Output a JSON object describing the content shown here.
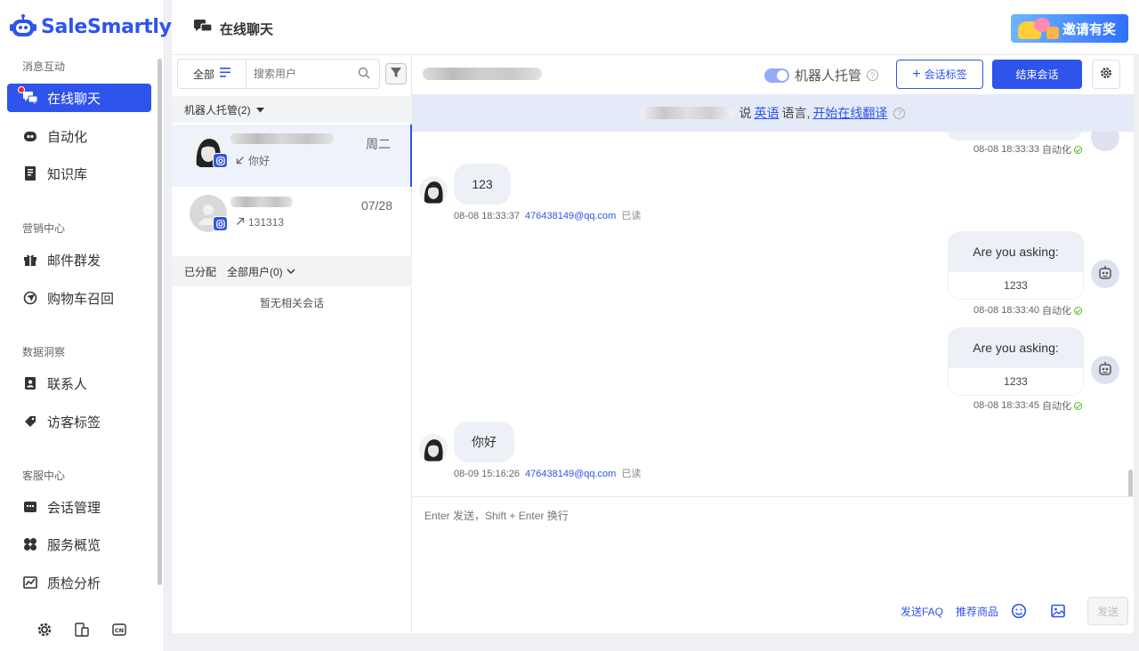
{
  "app": {
    "brand": "SaleSmartly",
    "invite_label": "邀请有奖"
  },
  "header": {
    "title": "在线聊天"
  },
  "sidebar": {
    "sections": [
      {
        "title": "消息互动",
        "items": [
          {
            "label": "在线聊天",
            "icon": "chat-icon",
            "active": true
          },
          {
            "label": "自动化",
            "icon": "robot-icon"
          },
          {
            "label": "知识库",
            "icon": "book-icon"
          }
        ]
      },
      {
        "title": "营销中心",
        "items": [
          {
            "label": "邮件群发",
            "icon": "gift-icon"
          },
          {
            "label": "购物车召回",
            "icon": "cart-recall-icon"
          }
        ]
      },
      {
        "title": "数据洞察",
        "items": [
          {
            "label": "联系人",
            "icon": "contact-icon"
          },
          {
            "label": "访客标签",
            "icon": "tag-icon"
          }
        ]
      },
      {
        "title": "客服中心",
        "items": [
          {
            "label": "会话管理",
            "icon": "session-icon"
          },
          {
            "label": "服务概览",
            "icon": "overview-icon"
          },
          {
            "label": "质检分析",
            "icon": "chart-icon"
          }
        ]
      }
    ],
    "bottom_icons": [
      "settings-icon",
      "device-icon",
      "language-icon"
    ],
    "language_code": "CN"
  },
  "conversation_list": {
    "filter_label": "全部",
    "search_placeholder": "搜索用户",
    "robot_group_label": "机器人托管(2)",
    "conversations": [
      {
        "date": "周二",
        "preview": "你好",
        "direction": "incoming"
      },
      {
        "date": "07/28",
        "preview": "131313",
        "direction": "outgoing"
      }
    ],
    "assigned_label": "已分配",
    "assigned_filter": "全部用户(0)",
    "empty_text": "暂无相关会话"
  },
  "chat": {
    "robot_toggle_label": "机器人托管",
    "tag_button": "会话标签",
    "end_button": "结束会话",
    "translate": {
      "says": "说",
      "language": "英语",
      "lang_suffix": "语言,",
      "action": "开始在线翻译"
    },
    "messages": [
      {
        "type": "out-meta",
        "time": "08-08 18:33:33",
        "source": "自动化"
      },
      {
        "type": "in",
        "text": "123",
        "time": "08-08 18:33:37",
        "email": "476438149@qq.com",
        "status": "已读"
      },
      {
        "type": "out-card",
        "text": "Are you asking:",
        "option": "1233",
        "time": "08-08 18:33:40",
        "source": "自动化"
      },
      {
        "type": "out-card",
        "text": "Are you asking:",
        "option": "1233",
        "time": "08-08 18:33:45",
        "source": "自动化"
      },
      {
        "type": "in",
        "text": "你好",
        "time": "08-09 15:16:26",
        "email": "476438149@qq.com",
        "status": "已读"
      }
    ],
    "composer": {
      "placeholder": "Enter 发送，Shift + Enter 换行",
      "faq_label": "发送FAQ",
      "product_label": "推荐商品",
      "send_label": "发送"
    }
  },
  "colors": {
    "primary": "#2f54eb",
    "sidebar_active": "#2f54eb",
    "badge": "#f5222d",
    "success": "#52c41a"
  }
}
